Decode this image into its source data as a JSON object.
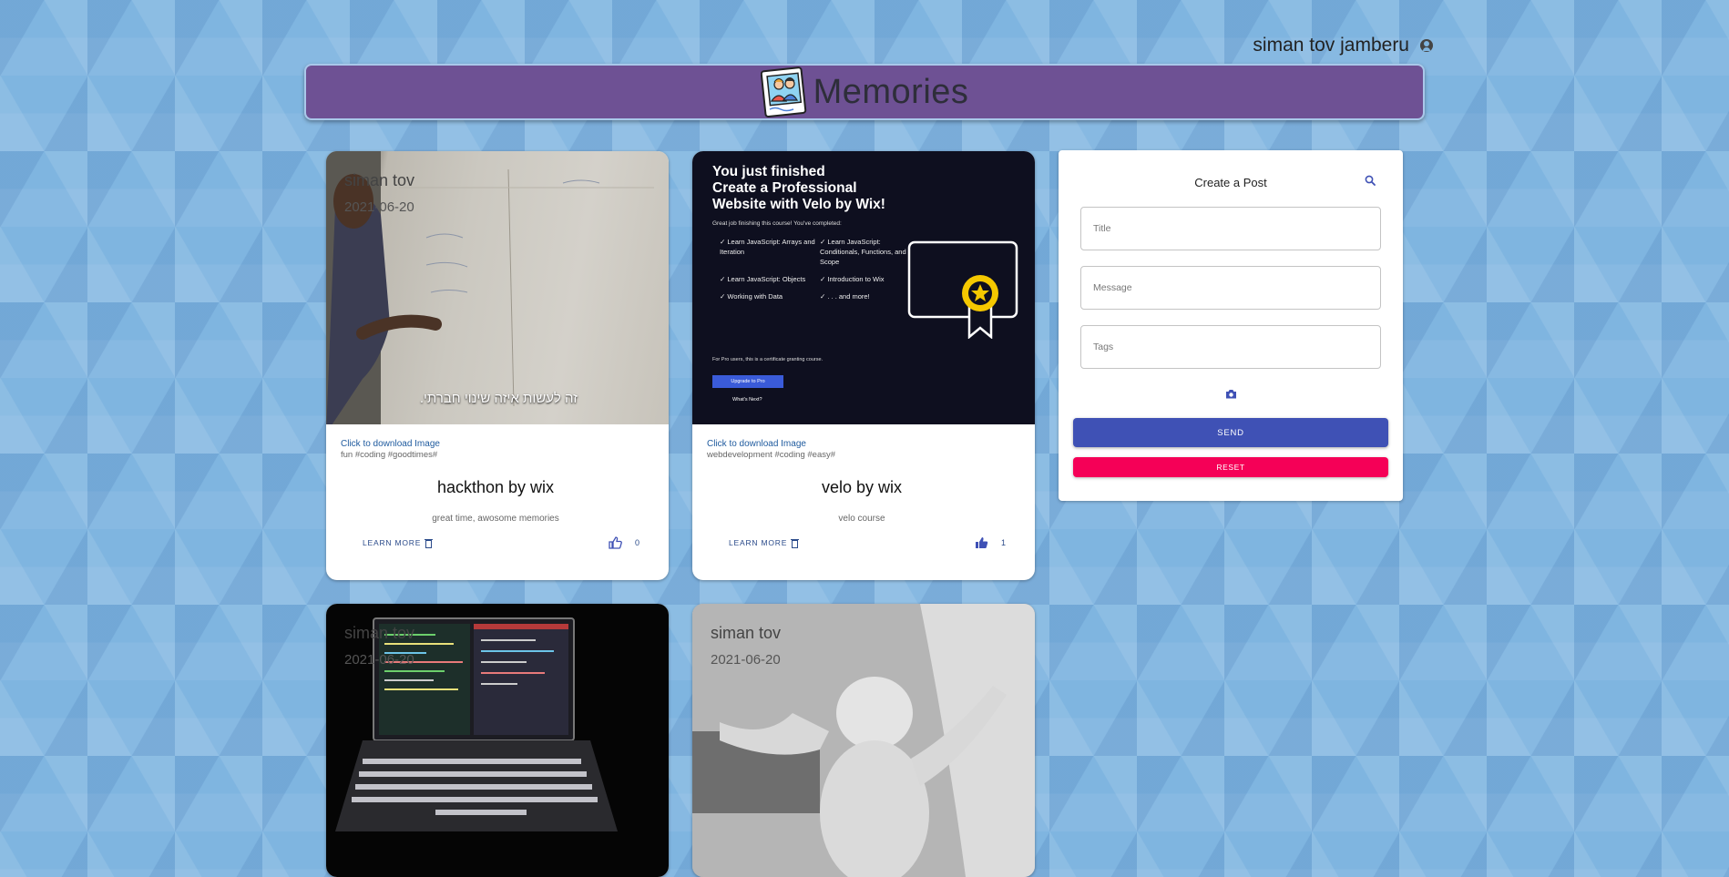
{
  "user": {
    "name": "siman tov jamberu",
    "icon": "account-circle-icon"
  },
  "header": {
    "title": "Memories",
    "logo": "memories-logo"
  },
  "posts": [
    {
      "author": "siman tov",
      "date": "2021-06-20",
      "download_link": "Click to download Image",
      "tags": "fun #coding #goodtimes#",
      "title": "hackthon by wix",
      "message": "great time, awosome memories",
      "learn_more": "LEARN MORE",
      "likes": "0",
      "image_caption": "זה לעשות איזה שינוי חברתי."
    },
    {
      "download_link": "Click to download Image",
      "tags": "webdevelopment #coding #easy#",
      "title": "velo by wix",
      "message": "velo course",
      "learn_more": "LEARN MORE",
      "likes": "1",
      "certificate": {
        "heading_lines": [
          "You just finished",
          "Create a Professional",
          "Website with Velo by Wix!"
        ],
        "subtext": "Great job finishing this course! You've completed:",
        "items": [
          "Learn JavaScript: Arrays and Iteration",
          "Learn JavaScript: Conditionals, Functions, and Scope",
          "Learn JavaScript: Objects",
          "Introduction to Wix",
          "Working with Data",
          ". . . and more!"
        ],
        "note": "For Pro users, this is a certificate granting course.",
        "upgrade_button": "Upgrade to Pro",
        "whats_next": "What's Next?"
      }
    },
    {
      "author": "siman tov",
      "date": "2021-06-20"
    },
    {
      "author": "siman tov",
      "date": "2021-06-20"
    }
  ],
  "form": {
    "title": "Create a Post",
    "title_placeholder": "Title",
    "message_placeholder": "Message",
    "tags_placeholder": "Tags",
    "send_label": "SEND",
    "reset_label": "RESET"
  },
  "colors": {
    "header_bg": "#6e5194",
    "send_button": "#3f51b5",
    "reset_button": "#f50057",
    "link": "#1e5a9e"
  }
}
